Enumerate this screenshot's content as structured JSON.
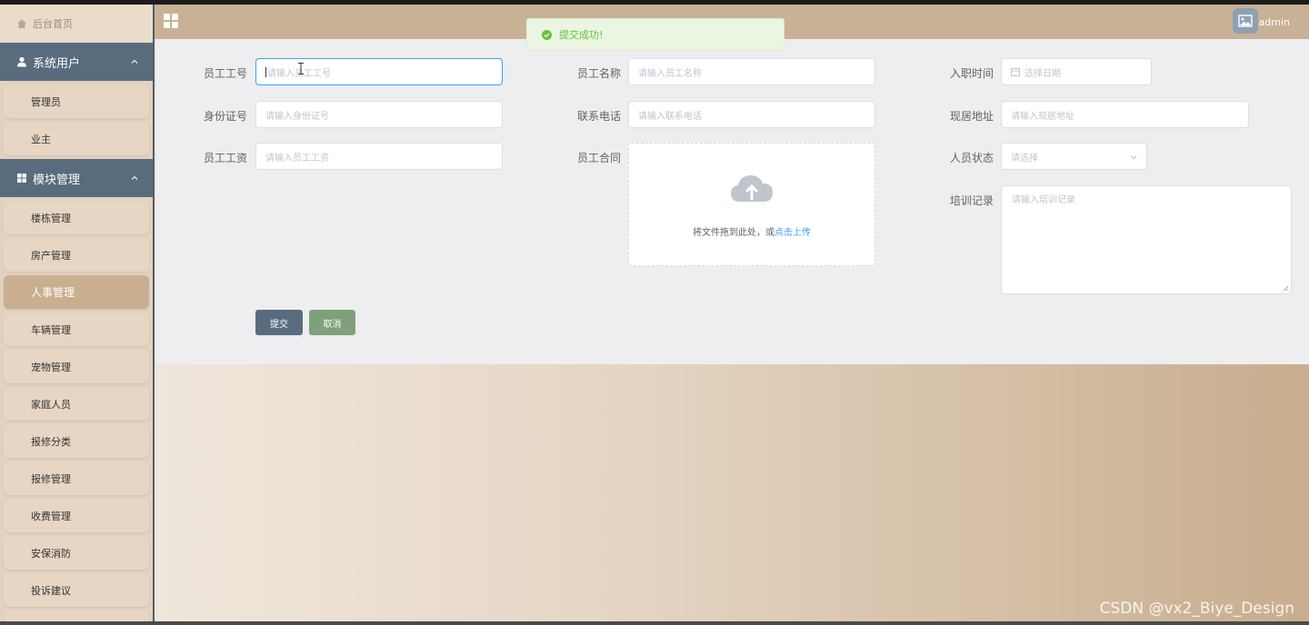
{
  "header": {
    "app_title": "",
    "username": "admin"
  },
  "toast": {
    "message": "提交成功!",
    "color": "#67c23a"
  },
  "sidebar": {
    "home_label": "后台首页",
    "groups": [
      {
        "label": "系统用户",
        "icon": "user-icon",
        "items": [
          {
            "label": "管理员"
          },
          {
            "label": "业主"
          }
        ]
      },
      {
        "label": "模块管理",
        "icon": "grid-icon",
        "items": [
          {
            "label": "楼栋管理"
          },
          {
            "label": "房产管理"
          },
          {
            "label": "人事管理",
            "active": true
          },
          {
            "label": "车辆管理"
          },
          {
            "label": "宠物管理"
          },
          {
            "label": "家庭人员"
          },
          {
            "label": "报修分类"
          },
          {
            "label": "报修管理"
          },
          {
            "label": "收费管理"
          },
          {
            "label": "安保消防"
          },
          {
            "label": "投诉建议"
          }
        ]
      }
    ]
  },
  "form": {
    "employee_no": {
      "label": "员工工号",
      "placeholder": "请输入员工工号"
    },
    "employee_name": {
      "label": "员工名称",
      "placeholder": "请输入员工名称"
    },
    "hire_date": {
      "label": "入职时间",
      "placeholder": "选择日期"
    },
    "id_number": {
      "label": "身份证号",
      "placeholder": "请输入身份证号"
    },
    "phone": {
      "label": "联系电话",
      "placeholder": "请输入联系电话"
    },
    "address": {
      "label": "现居地址",
      "placeholder": "请输入现居地址"
    },
    "salary": {
      "label": "员工工资",
      "placeholder": "请输入员工工资"
    },
    "contract": {
      "label": "员工合同",
      "upload_text": "将文件拖到此处，或",
      "upload_link": "点击上传"
    },
    "status": {
      "label": "人员状态",
      "placeholder": "请选择"
    },
    "training": {
      "label": "培训记录",
      "placeholder": "请输入培训记录"
    },
    "submit_label": "提交",
    "cancel_label": "取消"
  },
  "colors": {
    "sidebar_head": "#586c7e",
    "active_item": "#c9ae90",
    "focus": "#409eff",
    "link": "#409eff"
  },
  "watermark": "CSDN @vx2_Biye_Design"
}
